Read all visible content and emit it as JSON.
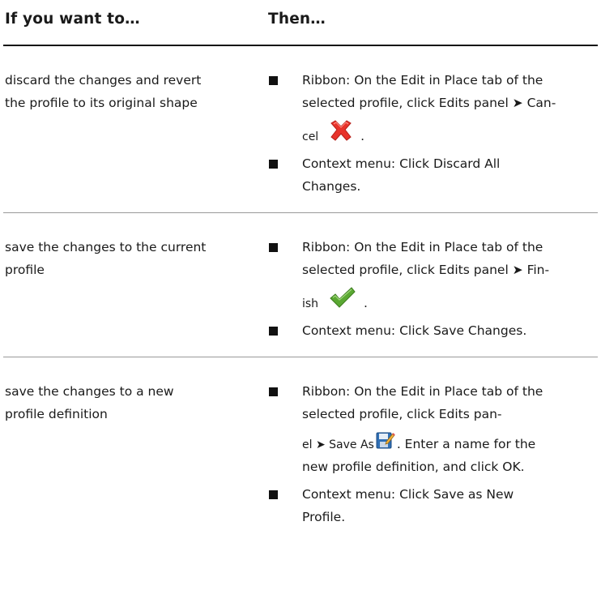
{
  "header": {
    "col1": "If you want to…",
    "col2": "Then…"
  },
  "rows": [
    {
      "condition": [
        "discard the changes and revert",
        "the profile to its original shape"
      ],
      "steps": [
        {
          "lines": [
            "Ribbon: On the Edit in Place tab of the",
            "selected profile, click Edits panel ➤ Can-"
          ],
          "icon_line_text": "cel",
          "icon": "red-x-cancel-icon",
          "icon_after": "."
        },
        {
          "lines": [
            "Context menu: Click Discard All",
            "Changes."
          ]
        }
      ]
    },
    {
      "condition": [
        "save the changes to the current",
        "profile"
      ],
      "steps": [
        {
          "lines": [
            "Ribbon: On the Edit in Place tab of the",
            "selected profile, click Edits panel ➤ Fin-"
          ],
          "icon_line_text": "ish",
          "icon": "green-check-finish-icon",
          "icon_after": "."
        },
        {
          "lines": [
            "Context menu: Click Save Changes."
          ]
        }
      ]
    },
    {
      "condition": [
        "save the changes to a new",
        "profile definition"
      ],
      "steps": [
        {
          "lines": [
            "Ribbon: On the Edit in Place tab of the",
            "selected profile, click Edits pan-"
          ],
          "icon_line_prefix": "el ➤ Save As",
          "icon": "save-as-icon",
          "icon_line_after": ". Enter a name for the",
          "lines_after": [
            "new profile definition, and click OK."
          ]
        },
        {
          "lines": [
            "Context menu: Click Save as New",
            "Profile."
          ]
        }
      ]
    }
  ],
  "colors": {
    "bullet": "#111111",
    "rule": "#9a9a9a",
    "cancel_red": "#e8332b",
    "finish_green": "#5aa832"
  }
}
